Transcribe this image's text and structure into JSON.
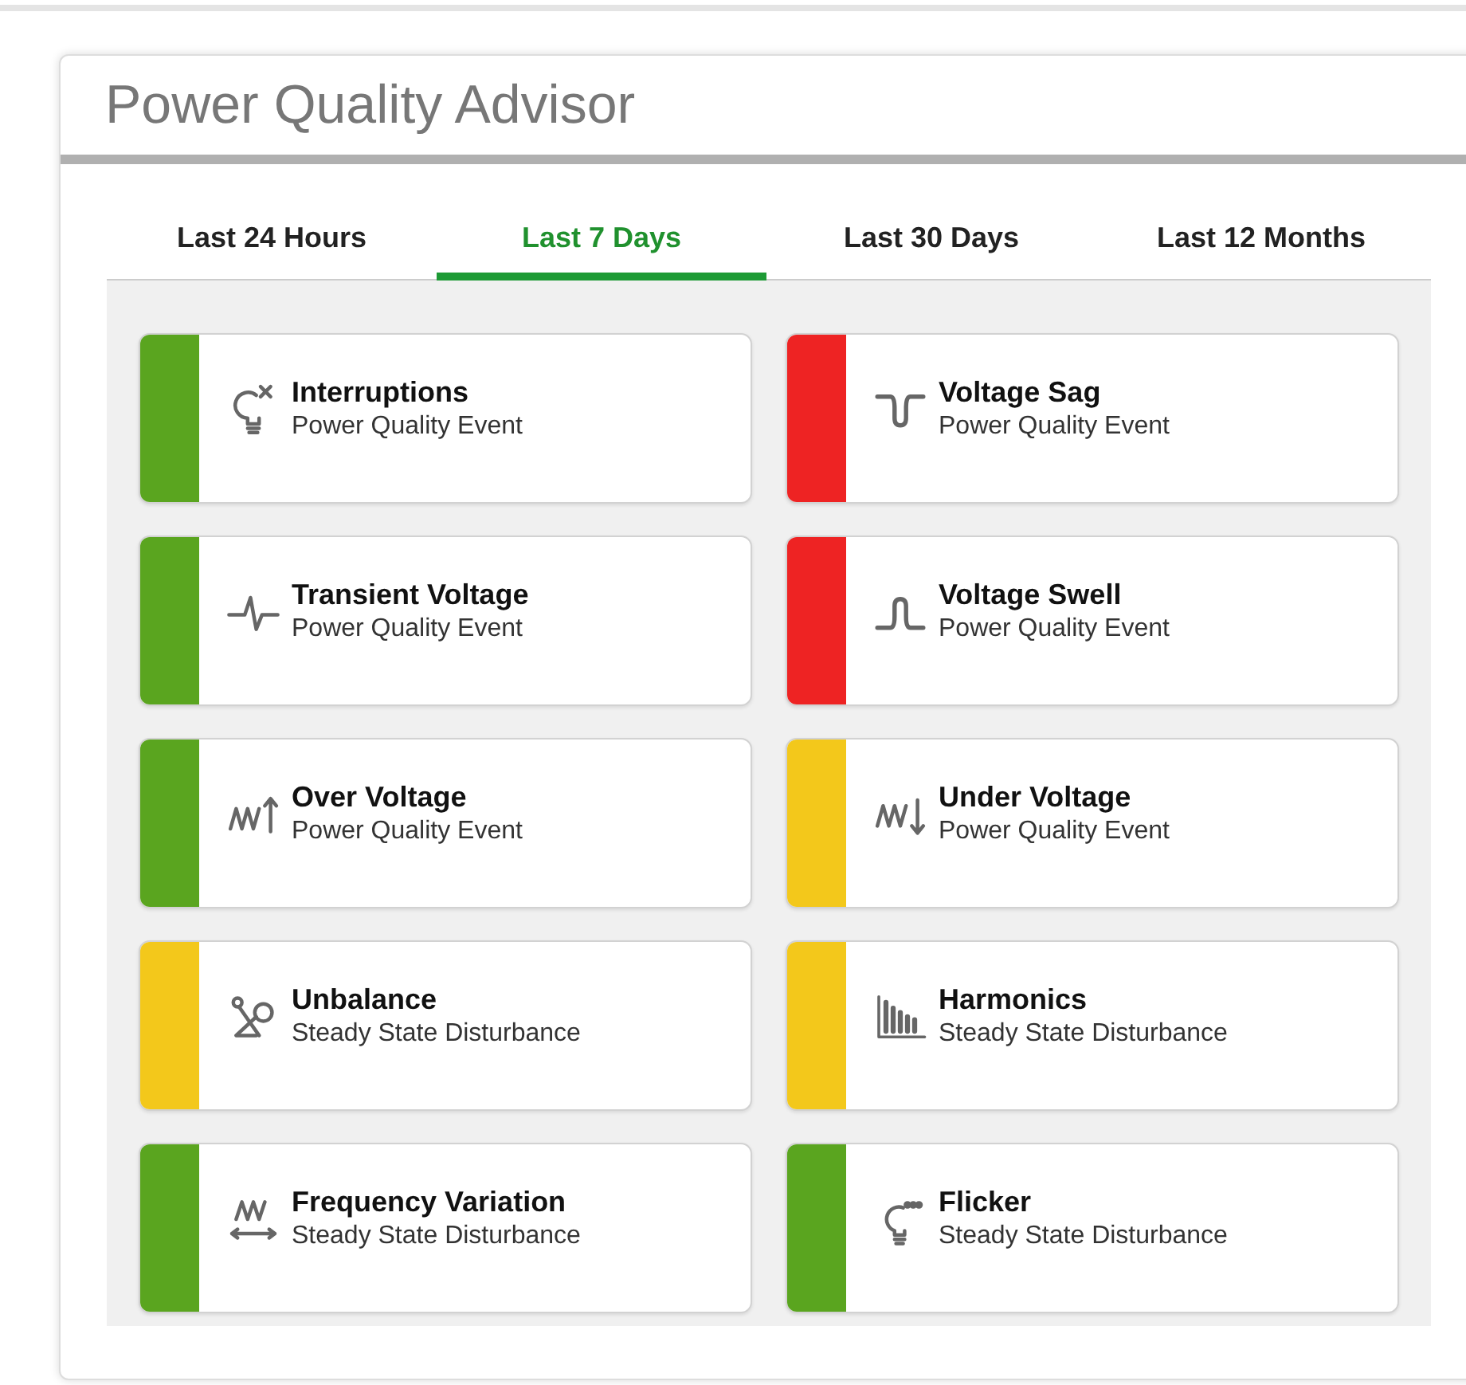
{
  "title": "Power Quality Advisor",
  "tabs": [
    {
      "label": "Last 24 Hours",
      "selected": false
    },
    {
      "label": "Last 7 Days",
      "selected": true
    },
    {
      "label": "Last 30 Days",
      "selected": false
    },
    {
      "label": "Last 12 Months",
      "selected": false
    }
  ],
  "cards": [
    {
      "name": "Interruptions",
      "category": "Power Quality Event",
      "color": "#5aa51f"
    },
    {
      "name": "Voltage Sag",
      "category": "Power Quality Event",
      "color": "#ee2323"
    },
    {
      "name": "Transient Voltage",
      "category": "Power Quality Event",
      "color": "#5aa51f"
    },
    {
      "name": "Voltage Swell",
      "category": "Power Quality Event",
      "color": "#ee2323"
    },
    {
      "name": "Over Voltage",
      "category": "Power Quality Event",
      "color": "#5aa51f"
    },
    {
      "name": "Under Voltage",
      "category": "Power Quality Event",
      "color": "#f3c81b"
    },
    {
      "name": "Unbalance",
      "category": "Steady State Disturbance",
      "color": "#f3c81b"
    },
    {
      "name": "Harmonics",
      "category": "Steady State Disturbance",
      "color": "#f3c81b"
    },
    {
      "name": "Frequency Variation",
      "category": "Steady State Disturbance",
      "color": "#5aa51f"
    },
    {
      "name": "Flicker",
      "category": "Steady State Disturbance",
      "color": "#5aa51f"
    }
  ]
}
